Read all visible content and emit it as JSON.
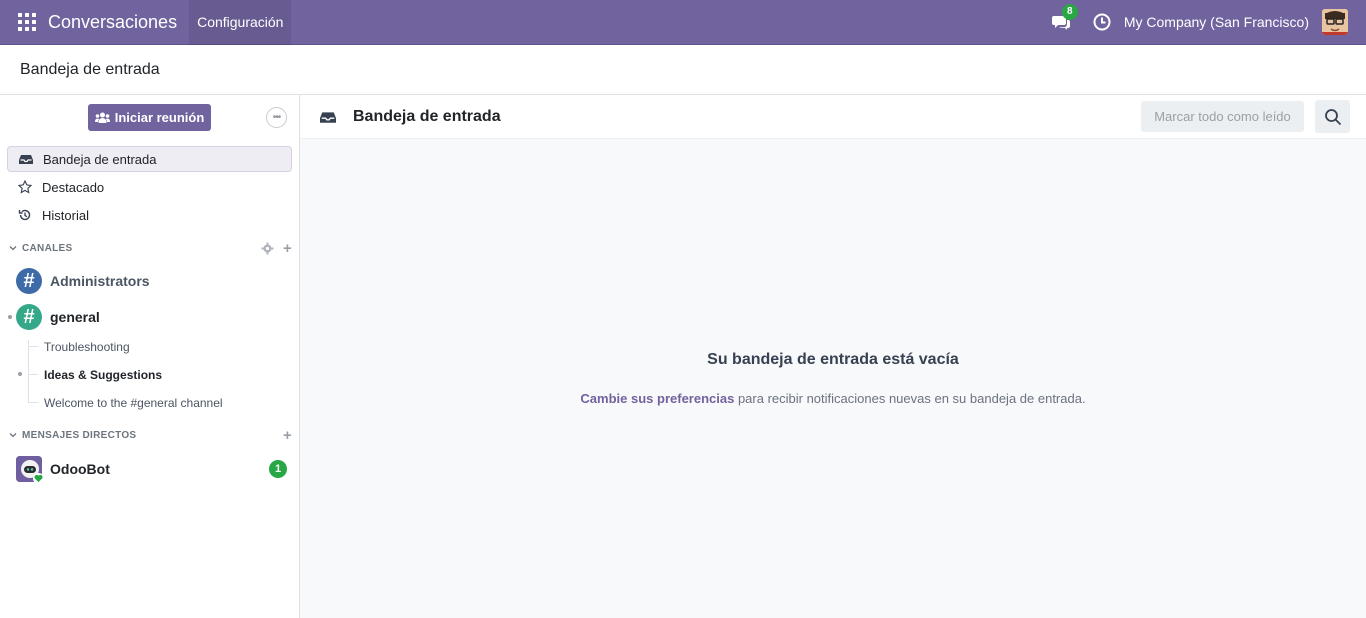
{
  "navbar": {
    "app_title": "Conversaciones",
    "menu_config": "Configuración",
    "chat_count": "8",
    "company": "My Company (San Francisco)",
    "bg_color": "#71639e"
  },
  "breadcrumb": "Bandeja de entrada",
  "sidebar": {
    "start_meeting": "Iniciar reunión",
    "mailboxes": [
      {
        "label": "Bandeja de entrada",
        "icon": "inbox-icon",
        "active": true
      },
      {
        "label": "Destacado",
        "icon": "star-icon",
        "active": false
      },
      {
        "label": "Historial",
        "icon": "history-icon",
        "active": false
      }
    ],
    "channels_header": "CANALES",
    "channels": [
      {
        "name": "Administrators",
        "color": "#3e6aa8"
      },
      {
        "name": "general",
        "color": "#35a889"
      }
    ],
    "threads": [
      {
        "name": "Troubleshooting"
      },
      {
        "name": "Ideas & Suggestions"
      },
      {
        "name": "Welcome to the #general channel"
      }
    ],
    "dm_header": "MENSAJES DIRECTOS",
    "dms": [
      {
        "name": "OdooBot",
        "unread": "1"
      }
    ]
  },
  "main": {
    "title": "Bandeja de entrada",
    "mark_all_read": "Marcar todo como leído",
    "empty_title": "Su bandeja de entrada está vacía",
    "empty_link": "Cambie sus preferencias",
    "empty_text": " para recibir notificaciones nuevas en su bandeja de entrada."
  }
}
